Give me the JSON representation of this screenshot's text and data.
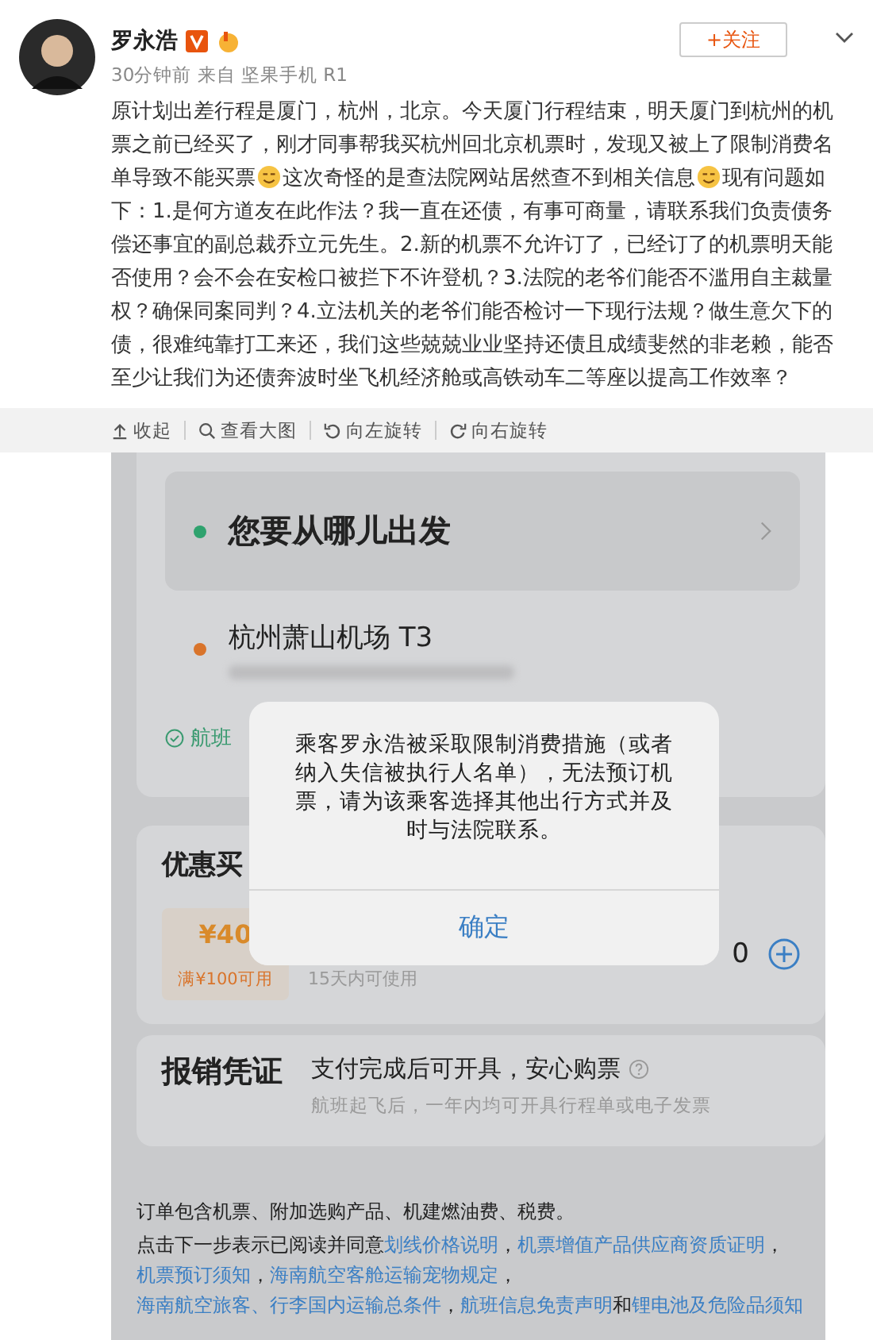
{
  "post": {
    "author": "罗永浩",
    "verified": true,
    "follow_button": "+关注",
    "meta": "30分钟前 来自 坚果手机 R1",
    "text_segments": [
      {
        "kind": "text",
        "text": "原计划出差行程是厦门，杭州，北京。今天厦门行程结束，明天厦门到杭州的机票之前已经买了，刚才同事帮我买杭州回北京机票时，发现又被上了限制消费名单导致不能买票"
      },
      {
        "kind": "emoji"
      },
      {
        "kind": "text",
        "text": "这次奇怪的是查法院网站居然查不到相关信息"
      },
      {
        "kind": "emoji"
      },
      {
        "kind": "text",
        "text": "现有问题如下：1.是何方道友在此作法？我一直在还债，有事可商量，请联系我们负责债务偿还事宜的副总裁乔立元先生。2.新的机票不允许订了，已经订了的机票明天能否使用？会不会在安检口被拦下不许登机？3.法院的老爷们能否不滥用自主裁量权？确保同案同判？4.立法机关的老爷们能否检讨一下现行法规？做生意欠下的债，很难纯靠打工来还，我们这些兢兢业业坚持还债且成绩斐然的非老赖，能否至少让我们为还债奔波时坐飞机经济舱或高铁动车二等座以提高工作效率？"
      }
    ],
    "actions": [
      {
        "kind": "collapse",
        "label": "收起"
      },
      {
        "kind": "zoom",
        "label": "查看大图"
      },
      {
        "kind": "rotate_left",
        "label": "向左旋转"
      },
      {
        "kind": "rotate_right",
        "label": "向右旋转"
      }
    ]
  },
  "screenshot": {
    "departure": "您要从哪儿出发",
    "arrival": "杭州萧山机场 T3",
    "flight_note": "航班",
    "offer_title": "优惠买",
    "coupon_amount": "¥40",
    "coupon_condition": "满¥100可用",
    "coupon_validity": "15天内可使用",
    "quantity": "0",
    "invoice_title": "报销凭证",
    "invoice_text": "支付完成后可开具，安心购票",
    "invoice_note": "航班起飞后，一年内均可开具行程单或电子发票",
    "footer_line": "订单包含机票、附加选购产品、机建燃油费、税费。",
    "consent": [
      {
        "kind": "text",
        "text": "点击下一步表示已阅读并同意"
      },
      {
        "kind": "link",
        "text": "划线价格说明"
      },
      {
        "kind": "text",
        "text": "，"
      },
      {
        "kind": "link",
        "text": "机票增值产品供应商资质证明"
      },
      {
        "kind": "text",
        "text": "，"
      },
      {
        "kind": "link",
        "text": "机票预订须知"
      },
      {
        "kind": "text",
        "text": "，"
      },
      {
        "kind": "link",
        "text": "海南航空客舱运输宠物规定"
      },
      {
        "kind": "text",
        "text": "，"
      },
      {
        "kind": "link",
        "text": "海南航空旅客、行李国内运输总条件"
      },
      {
        "kind": "text",
        "text": "，"
      },
      {
        "kind": "link",
        "text": "航班信息免责声明"
      },
      {
        "kind": "text",
        "text": "和"
      },
      {
        "kind": "link",
        "text": "锂电池及危险品须知"
      }
    ],
    "dialog": {
      "message": "乘客罗永浩被采取限制消费措施（或者纳入失信被执行人名单），无法预订机票，请为该乘客选择其他出行方式并及时与法院联系。",
      "button": "确定"
    }
  }
}
